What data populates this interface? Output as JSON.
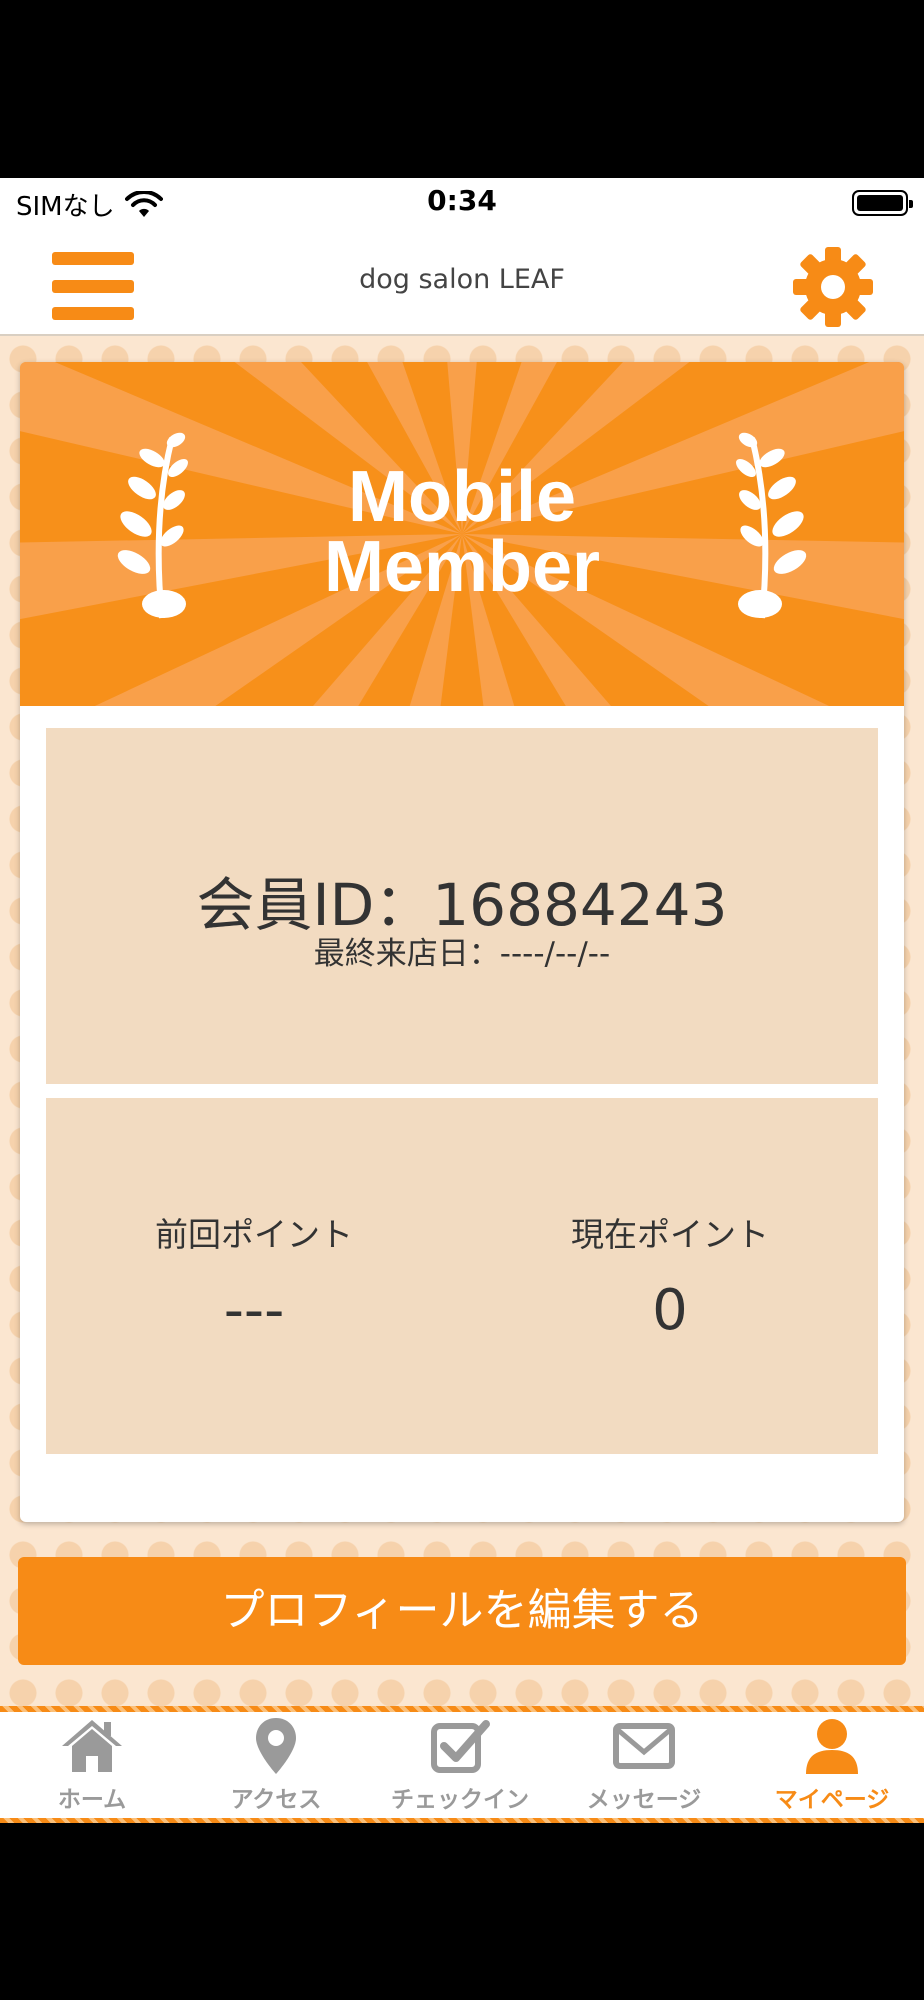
{
  "status_bar": {
    "carrier": "SIMなし",
    "time": "0:34"
  },
  "header": {
    "title": "dog salon LEAF"
  },
  "banner": {
    "line1": "Mobile",
    "line2": "Member"
  },
  "member": {
    "id_text": "会員ID：16884243",
    "last_visit_text": "最終来店日：----/--/--"
  },
  "points": {
    "previous_label": "前回ポイント",
    "previous_value": "---",
    "current_label": "現在ポイント",
    "current_value": "0"
  },
  "edit_profile_label": "プロフィールを編集する",
  "tabs": [
    {
      "label": "ホーム",
      "icon": "home-icon",
      "active": false
    },
    {
      "label": "アクセス",
      "icon": "map-pin-icon",
      "active": false
    },
    {
      "label": "チェックイン",
      "icon": "checkbox-icon",
      "active": false
    },
    {
      "label": "メッセージ",
      "icon": "mail-icon",
      "active": false
    },
    {
      "label": "マイページ",
      "icon": "user-icon",
      "active": true
    }
  ],
  "colors": {
    "accent": "#f78b16",
    "panel": "#f2dbc1",
    "inactive_tab": "#9a9a9a"
  }
}
